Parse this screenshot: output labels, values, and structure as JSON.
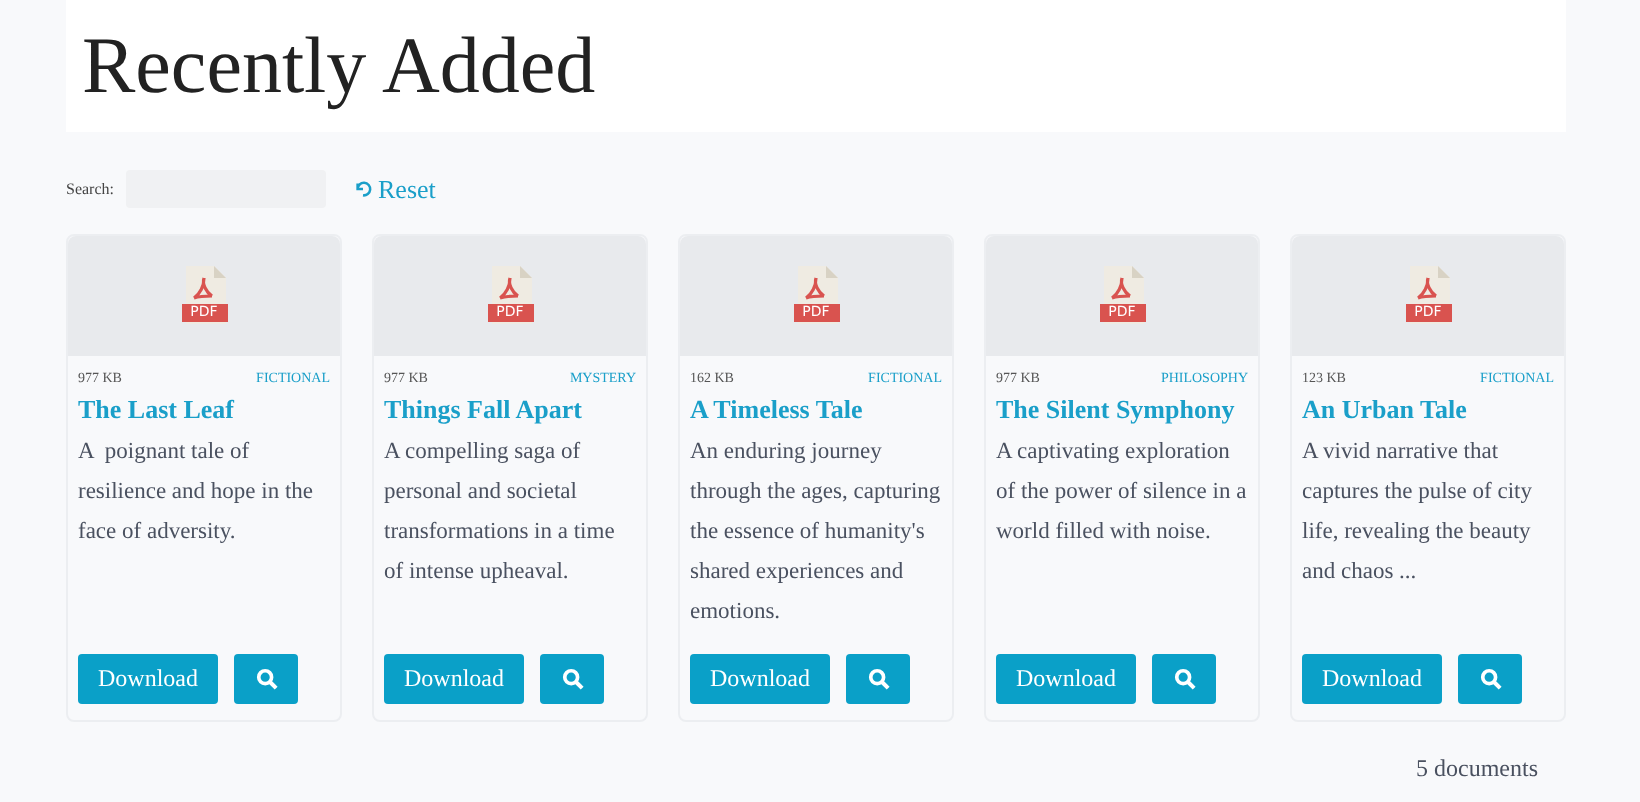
{
  "header": {
    "title": "Recently Added"
  },
  "search": {
    "label": "Search:",
    "reset": "Reset"
  },
  "documents": [
    {
      "file_type": "PDF",
      "size": "977 KB",
      "category": "FICTIONAL",
      "title": "The Last Leaf",
      "description": "A  poignant tale of resilience and hope in the face of adversity.",
      "download": "Download"
    },
    {
      "file_type": "PDF",
      "size": "977 KB",
      "category": "MYSTERY",
      "title": "Things Fall Apart",
      "description": "A compelling saga of personal and societal transformations in a time of intense upheaval.",
      "download": "Download"
    },
    {
      "file_type": "PDF",
      "size": "162 KB",
      "category": "FICTIONAL",
      "title": "A Timeless Tale",
      "description": "An enduring journey through the ages, capturing the essence of humanity's shared experiences and emotions.",
      "download": "Download"
    },
    {
      "file_type": "PDF",
      "size": "977 KB",
      "category": "PHILOSOPHY",
      "title": "The Silent Symphony",
      "description": "A captivating exploration of the power of silence in a world filled with noise.",
      "download": "Download"
    },
    {
      "file_type": "PDF",
      "size": "123 KB",
      "category": "FICTIONAL",
      "title": "An Urban Tale",
      "description": "A vivid narrative that captures the pulse of city life, revealing the beauty and chaos ...",
      "download": "Download"
    }
  ],
  "footer": {
    "count": "5 documents"
  }
}
